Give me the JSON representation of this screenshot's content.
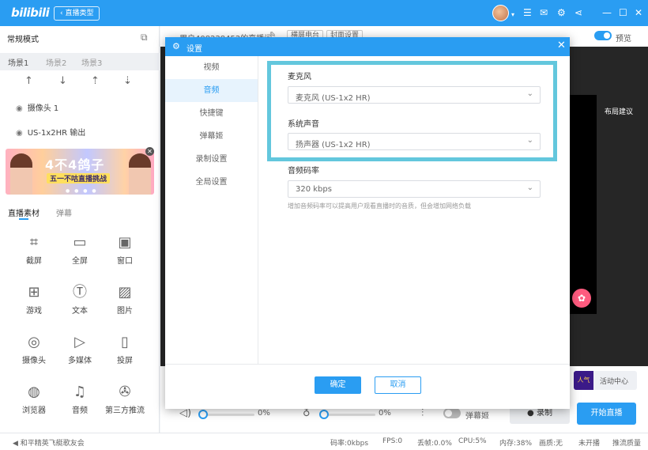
{
  "topbar": {
    "logo": "bilibili",
    "back_label": "直播类型",
    "icons": [
      "avatar",
      "menu-icon",
      "mail-icon",
      "gear-icon",
      "share-icon",
      "minimize-icon",
      "maximize-icon",
      "close-icon"
    ]
  },
  "left": {
    "mode_title": "常规模式",
    "scenes": [
      "场景1",
      "场景2",
      "场景3"
    ],
    "sources": [
      "摄像头 1",
      "US-1x2HR 输出"
    ],
    "banner": {
      "title": "4不4鸽子",
      "subtitle": "五一不咕直播挑战"
    },
    "material_tabs": [
      "直播素材",
      "弹幕"
    ],
    "tools": [
      {
        "label": "截屏",
        "icon": "crop-icon"
      },
      {
        "label": "全屏",
        "icon": "monitor-icon"
      },
      {
        "label": "窗口",
        "icon": "window-icon"
      },
      {
        "label": "游戏",
        "icon": "gamepad-icon"
      },
      {
        "label": "文本",
        "icon": "text-icon"
      },
      {
        "label": "图片",
        "icon": "image-icon"
      },
      {
        "label": "摄像头",
        "icon": "webcam-icon"
      },
      {
        "label": "多媒体",
        "icon": "media-icon"
      },
      {
        "label": "投屏",
        "icon": "phone-cast-icon"
      },
      {
        "label": "浏览器",
        "icon": "planet-icon"
      },
      {
        "label": "音频",
        "icon": "music-icon"
      },
      {
        "label": "第三方推流",
        "icon": "stream-icon"
      }
    ]
  },
  "header": {
    "room_title": "用户408228452的直播间",
    "btn1": "横屏电台",
    "btn2": "封面设置",
    "preview_label": "预览"
  },
  "preview": {
    "layout_hint": "布局建议"
  },
  "settings_dialog": {
    "title": "设置",
    "nav": [
      "视频",
      "音频",
      "快捷键",
      "弹幕姬",
      "录制设置",
      "全局设置"
    ],
    "active_nav": "音频",
    "mic_label": "麦克风",
    "mic_value": "麦克风 (US-1x2 HR)",
    "system_audio_label": "系统声音",
    "system_audio_value": "扬声器 (US-1x2 HR)",
    "bitrate_label": "音频码率",
    "bitrate_value": "320 kbps",
    "bitrate_hint": "增加音频码率可以提高用户观看直播时的音质，但会增加网络负载",
    "ok": "确定",
    "cancel": "取消"
  },
  "controls": {
    "speaker_pct": "0%",
    "mic_pct": "0%",
    "danmaku_label": "弹幕姬",
    "record": "录制",
    "start_live": "开始直播",
    "activity": "活动中心"
  },
  "status": {
    "left_text": "和平精英飞艇歌友会",
    "bitrate": "码率:0kbps",
    "fps": "FPS:0",
    "drop": "丢帧:0.0%",
    "cpu": "CPU:5%",
    "mem": "内存:38%",
    "quality": "画质:无",
    "live": "未开播",
    "push_quality": "推流质量"
  }
}
